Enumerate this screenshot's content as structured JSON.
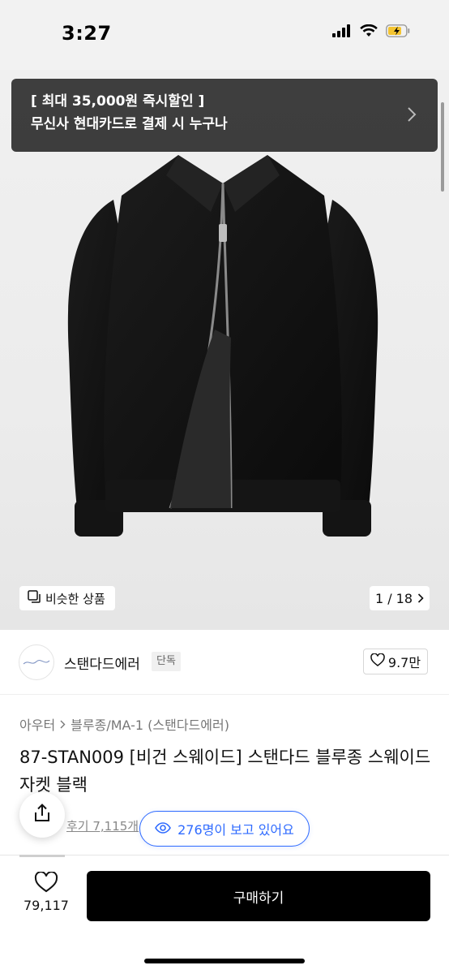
{
  "status_bar": {
    "time": "3:27"
  },
  "promo": {
    "line1": "[ 최대 35,000원 즉시할인 ]",
    "line2": "무신사 현대카드로 결제 시 누구나"
  },
  "gallery": {
    "similar_label": "비슷한 상품",
    "page_counter": "1 / 18"
  },
  "brand": {
    "name": "스탠다드에러",
    "tag": "단독",
    "like_count": "9.7만"
  },
  "product": {
    "breadcrumb": [
      "아우터",
      "블루종/MA-1 (스탠다드에러)"
    ],
    "title": "87-STAN009 [비건 스웨이드] 스탠다드 블루종 스웨이드 자켓 블랙",
    "review_link": "후기 7,115개",
    "viewers": "276명이 보고 있어요"
  },
  "bottom_bar": {
    "wish_count": "79,117",
    "buy_label": "구매하기"
  },
  "colors": {
    "accent_blue": "#2f6bff",
    "buy_button": "#000000",
    "promo_bg": "#323232"
  },
  "icons": [
    "signal-icon",
    "wifi-icon",
    "battery-charging-icon",
    "chevron-right-icon",
    "similar-products-icon",
    "heart-icon",
    "share-icon",
    "eye-icon"
  ]
}
